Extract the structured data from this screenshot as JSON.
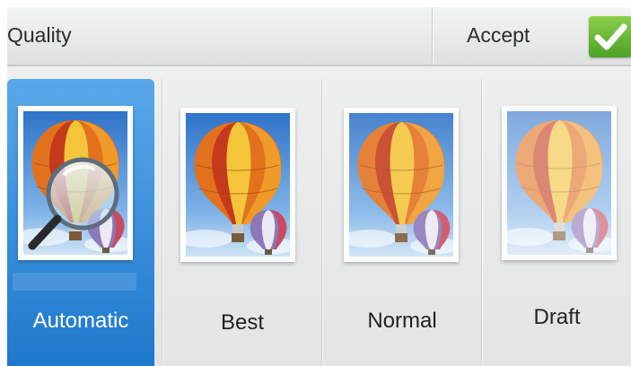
{
  "header": {
    "title": "Quality",
    "accept_label": "Accept"
  },
  "options": [
    {
      "label": "Automatic",
      "selected": true,
      "icon": "magnifier-balloon-icon"
    },
    {
      "label": "Best",
      "selected": false,
      "icon": "balloon-best-icon"
    },
    {
      "label": "Normal",
      "selected": false,
      "icon": "balloon-normal-icon"
    },
    {
      "label": "Draft",
      "selected": false,
      "icon": "balloon-draft-icon"
    }
  ],
  "colors": {
    "selected": "#2b86d8",
    "accept": "#6bbf3a"
  }
}
